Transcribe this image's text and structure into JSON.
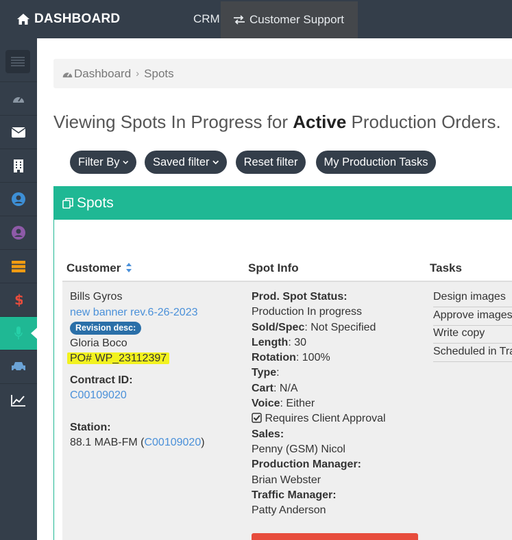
{
  "topbar": {
    "brand": "DASHBOARD",
    "crm": "CRM",
    "customer_support": "Customer Support"
  },
  "breadcrumb": {
    "home": "Dashboard",
    "current": "Spots"
  },
  "title": {
    "prefix": "Viewing Spots In Progress for",
    "emphasis": "Active",
    "suffix": "Production Orders."
  },
  "filters": {
    "filter_by": "Filter By",
    "saved_filter": "Saved filter",
    "reset": "Reset filter",
    "my_tasks": "My Production Tasks"
  },
  "panel": {
    "title": "Spots"
  },
  "table": {
    "headers": {
      "customer": "Customer",
      "spot_info": "Spot Info",
      "tasks": "Tasks"
    },
    "row": {
      "customer": {
        "name": "Bills Gyros",
        "link": "new banner rev.6-26-2023",
        "badge": "Revision desc:",
        "contact": "Gloria Boco",
        "po": "PO# WP_23112397",
        "contract_label": "Contract ID:",
        "contract_id": "C00109020",
        "station_label": "Station:",
        "station_name": "88.1 MAB-FM (",
        "station_link": "C00109020",
        "station_close": ")"
      },
      "spot": {
        "status_label": "Prod. Spot Status:",
        "status_value": "Production In progress",
        "soldspec_label": "Sold/Spec",
        "soldspec_value": ": Not Specified",
        "length_label": "Length",
        "length_value": ": 30",
        "rotation_label": "Rotation",
        "rotation_value": ": 100%",
        "type_label": "Type",
        "type_value": ":",
        "cart_label": "Cart",
        "cart_value": ": N/A",
        "voice_label": "Voice",
        "voice_value": ": Either",
        "approval": "Requires Client Approval",
        "sales_label": "Sales:",
        "sales_value": "Penny (GSM) Nicol",
        "pm_label": "Production Manager:",
        "pm_value": "Brian Webster",
        "tm_label": "Traffic Manager:",
        "tm_value": "Patty Anderson"
      },
      "tasks": [
        "Design images",
        "Approve images",
        "Write copy",
        "Scheduled in Traffic"
      ]
    }
  },
  "colors": {
    "navbar": "#343e4a",
    "accent": "#1fb894",
    "link": "#4a90d9",
    "highlight": "#f2f21f",
    "danger": "#e74c3c"
  },
  "icons": {
    "brand": "home-icon",
    "customer_support": "exchange-icon",
    "sidebar": [
      "menu-icon",
      "dashboard-icon",
      "envelope-icon",
      "building-icon",
      "user-circle-icon",
      "user-circle-purple-icon",
      "server-icon",
      "dollar-icon",
      "microphone-icon",
      "car-icon",
      "line-chart-icon"
    ]
  }
}
